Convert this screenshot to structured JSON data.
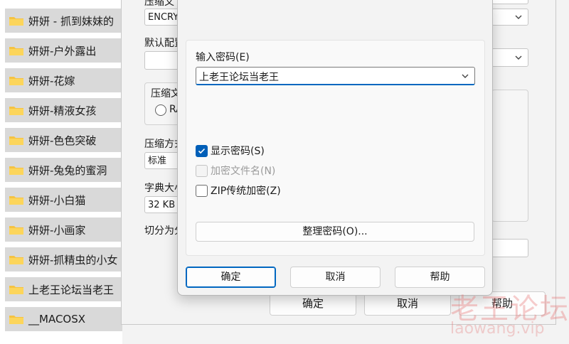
{
  "folders": [
    {
      "name": "妍妍 - 抓到妹妹的"
    },
    {
      "name": "妍妍-户外露出"
    },
    {
      "name": "妍妍-花嫁"
    },
    {
      "name": "妍妍-精液女孩"
    },
    {
      "name": "妍妍-色色突破"
    },
    {
      "name": "妍妍-兔兔的蜜洞"
    },
    {
      "name": "妍妍-小白猫"
    },
    {
      "name": "妍妍-小画家"
    },
    {
      "name": "妍妍-抓精虫的小女"
    },
    {
      "name": "上老王论坛当老王"
    },
    {
      "name": "__MACOSX"
    }
  ],
  "archive_dialog": {
    "label_format": "压缩文",
    "format_value": "ENCRY",
    "label_default": "默认配置",
    "group_label": "压缩文",
    "radio_label": "RA",
    "label_method": "压缩方式",
    "method_value": "标准",
    "label_dict": "字典大小",
    "dict_value": "32 KB",
    "label_split": "切分为分卷",
    "ok": "确定",
    "cancel": "取消",
    "help": "帮助"
  },
  "password_dialog": {
    "label": "输入密码(E)",
    "password_value": "上老王论坛当老王",
    "show_password": {
      "label": "显示密码(S)",
      "checked": true
    },
    "encrypt_names": {
      "label": "加密文件名(N)",
      "checked": false,
      "disabled": true
    },
    "zip_legacy": {
      "label": "ZIP传统加密(Z)",
      "checked": false
    },
    "manage": "整理密码(O)...",
    "ok": "确定",
    "cancel": "取消",
    "help": "帮助"
  },
  "watermark": {
    "main": "老王论坛",
    "sub": "laowang.vip"
  },
  "colors": {
    "accent": "#005fb8",
    "folder": "#f5c342",
    "watermark": "#e66e6e"
  }
}
